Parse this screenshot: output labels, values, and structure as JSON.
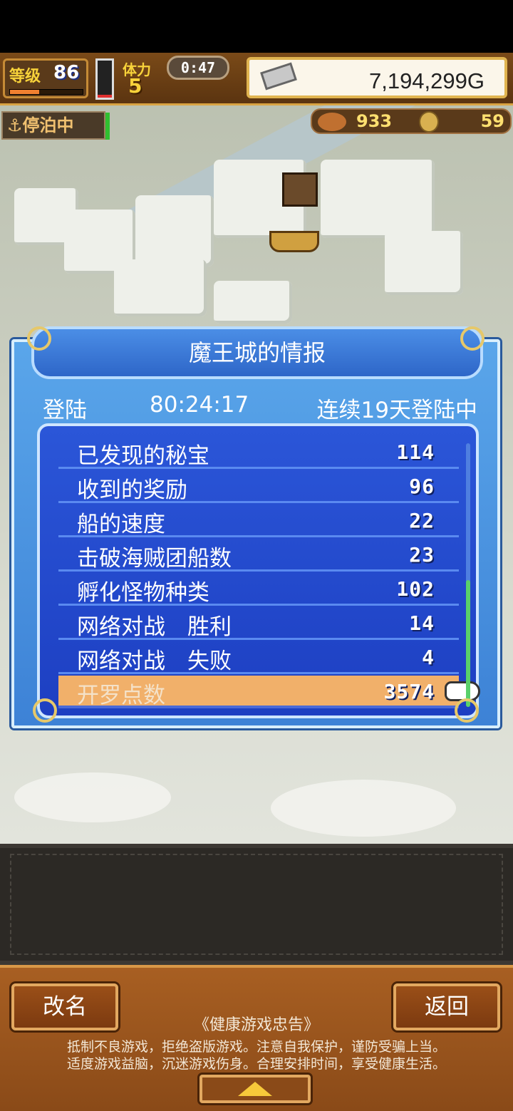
{
  "hud": {
    "level_label": "等级",
    "level_value": "86",
    "stamina_label": "体力",
    "stamina_value": "5",
    "timer": "0:47",
    "gold": "7,194,299G",
    "docked_label": "停泊中",
    "resource1": "933",
    "resource2": "59"
  },
  "dialog": {
    "title": "魔王城的情报",
    "login_label": "登陆",
    "login_time": "80:24:17",
    "streak": "连续19天登陆中",
    "rows": [
      {
        "label": "已发现的秘宝",
        "value": "114"
      },
      {
        "label": "收到的奖励",
        "value": "96"
      },
      {
        "label": "船的速度",
        "value": "22"
      },
      {
        "label": "击破海贼团船数",
        "value": "23"
      },
      {
        "label": "孵化怪物种类",
        "value": "102"
      },
      {
        "label": "网络对战　胜利",
        "value": "14"
      },
      {
        "label": "网络对战　失败",
        "value": "4"
      },
      {
        "label": "开罗点数",
        "value": "3574"
      }
    ],
    "selected_index": 7
  },
  "bottom": {
    "rename_label": "改名",
    "back_label": "返回",
    "advice_title": "《健康游戏忠告》",
    "advice_line1": "抵制不良游戏，拒绝盗版游戏。注意自我保护，谨防受骗上当。",
    "advice_line2": "适度游戏益脑，沉迷游戏伤身。合理安排时间，享受健康生活。"
  },
  "icons": {
    "gold": "silver-bar-icon",
    "resource1": "wood-log-icon",
    "resource2": "coin-icon",
    "pointer": "pointing-hand-icon",
    "docked": "anchor-icon",
    "up": "up-arrow-icon"
  }
}
